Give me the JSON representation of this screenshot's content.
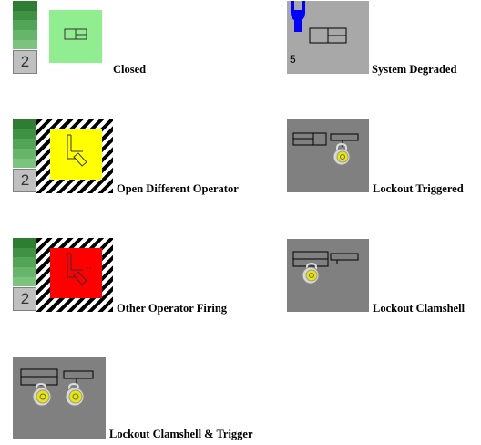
{
  "legend": [
    {
      "label": "Closed",
      "count": "2"
    },
    {
      "label": "System Degraded",
      "count": "5"
    },
    {
      "label": "Open Different Operator",
      "count": "2"
    },
    {
      "label": "Lockout Triggered"
    },
    {
      "label": "Other Operator Firing",
      "count": "2"
    },
    {
      "label": "Lockout Clamshell"
    },
    {
      "label": "Lockout Clamshell & Trigger"
    }
  ],
  "colors": {
    "closed": "#90ee90",
    "open_different_operator": "#ffff00",
    "other_operator_firing": "#ff0000",
    "lockout_tile": "#808080",
    "degraded_tile": "#a8a8a8",
    "wrench": "#0000ff",
    "meter_greens": [
      "#2e7d32",
      "#3f9143",
      "#52a556",
      "#66b56a",
      "#7cc47e",
      "#94d296",
      "#ace0ad"
    ]
  },
  "icons": [
    "wrench-icon",
    "padlock-icon",
    "valve-closed-icon",
    "valve-open-icon"
  ]
}
